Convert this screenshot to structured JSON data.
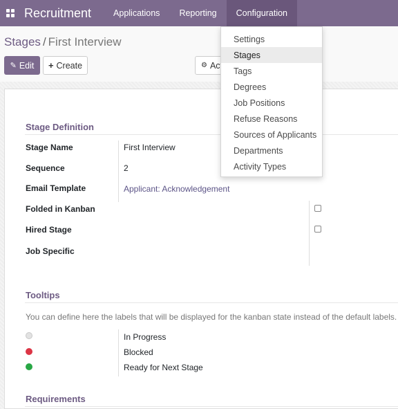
{
  "navbar": {
    "brand": "Recruitment",
    "menus": [
      "Applications",
      "Reporting",
      "Configuration"
    ]
  },
  "breadcrumb": {
    "parent": "Stages",
    "separator": "/",
    "current": "First Interview"
  },
  "controls": {
    "edit": "Edit",
    "create": "Create",
    "action": "Action"
  },
  "config_menu": {
    "items": [
      "Settings",
      "Stages",
      "Tags",
      "Degrees",
      "Job Positions",
      "Refuse Reasons",
      "Sources of Applicants",
      "Departments",
      "Activity Types"
    ],
    "active": "Stages"
  },
  "stage_definition": {
    "title": "Stage Definition",
    "stage_name_label": "Stage Name",
    "stage_name": "First Interview",
    "sequence_label": "Sequence",
    "sequence": "2",
    "email_template_label": "Email Template",
    "email_template": "Applicant: Acknowledgement",
    "folded_label": "Folded in Kanban",
    "hired_label": "Hired Stage",
    "job_specific_label": "Job Specific"
  },
  "tooltips": {
    "title": "Tooltips",
    "help": "You can define here the labels that will be displayed for the kanban state instead of the default labels.",
    "states": [
      {
        "label": "In Progress",
        "color": "#e2e2e2"
      },
      {
        "label": "Blocked",
        "color": "#dc3545"
      },
      {
        "label": "Ready for Next Stage",
        "color": "#28a745"
      }
    ]
  },
  "requirements": {
    "title": "Requirements"
  },
  "colors": {
    "brand": "#7c6a8e",
    "link": "#5c5487"
  }
}
